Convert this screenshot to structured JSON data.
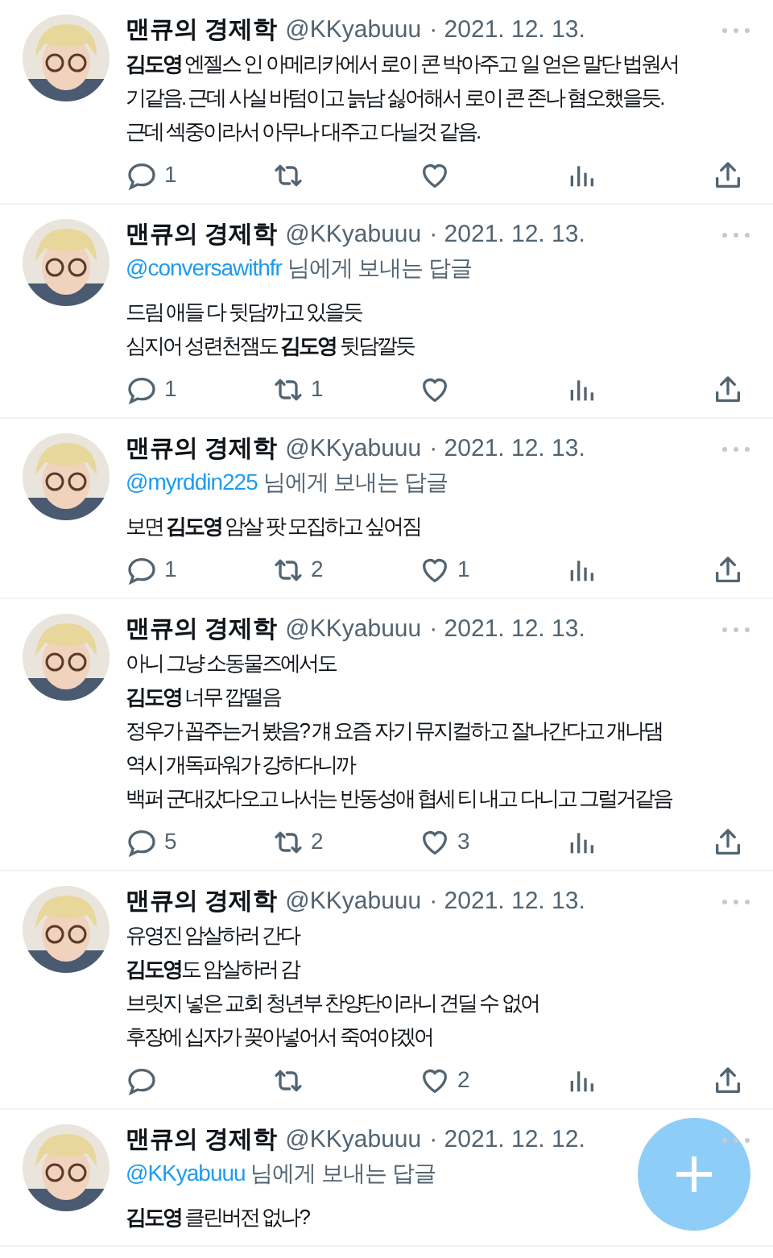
{
  "tweets": [
    {
      "name": "맨큐의 경제학",
      "handle": "@KKyabuuu",
      "date": "· 2021. 12. 13.",
      "lines": [
        "**김도영** 엔젤스 인 아메리카에서 로이 콘 박아주고 일 얻은 말단 법원서",
        "기같음. 근데 사실 바텀이고 늙남 싫어해서 로이 콘 존나 혐오했을듯.",
        "근데 섹중이라서 아무나 대주고 다닐것 같음."
      ],
      "actions": {
        "reply": "1"
      }
    },
    {
      "name": "맨큐의 경제학",
      "handle": "@KKyabuuu",
      "date": "· 2021. 12. 13.",
      "reply_to": {
        "handle": "@conversawithfr",
        "suffix": "님에게 보내는 답글"
      },
      "lines": [
        "드림 애들 다 뒷담까고 있을듯",
        "심지어 성련천잼도 **김도영** 뒷담깔듯"
      ],
      "actions": {
        "reply": "1",
        "retweet": "1"
      }
    },
    {
      "name": "맨큐의 경제학",
      "handle": "@KKyabuuu",
      "date": "· 2021. 12. 13.",
      "reply_to": {
        "handle": "@myrddin225",
        "suffix": "님에게 보내는 답글"
      },
      "lines": [
        "보면 **김도영** 암살 팟 모집하고 싶어짐"
      ],
      "actions": {
        "reply": "1",
        "retweet": "2",
        "like": "1"
      }
    },
    {
      "name": "맨큐의 경제학",
      "handle": "@KKyabuuu",
      "date": "· 2021. 12. 13.",
      "lines": [
        "아니 그냥 소동물즈에서도",
        "**김도영** 너무 깝떨음",
        "정우가 꼽주는거 봤음? 걔 요즘 자기 뮤지컬하고 잘나간다고 개나댐",
        "역시 개독파워가 강하다니까",
        "백퍼 군대갔다오고 나서는 반동성애 협세 티 내고 다니고 그럴거같음"
      ],
      "actions": {
        "reply": "5",
        "retweet": "2",
        "like": "3"
      }
    },
    {
      "name": "맨큐의 경제학",
      "handle": "@KKyabuuu",
      "date": "· 2021. 12. 13.",
      "lines": [
        "유영진 암살하러 간다",
        "**김도영**도 암살하러 감",
        "브릿지 넣은 교회 청년부 찬양단이라니 견딜 수 없어",
        "후장에 십자가 꽂아넣어서 죽여야겠어"
      ],
      "actions": {
        "like": "2"
      }
    },
    {
      "name": "맨큐의 경제학",
      "handle": "@KKyabuuu",
      "date": "· 2021. 12. 12.",
      "reply_to": {
        "handle": "@KKyabuuu",
        "suffix": "님에게 보내는 답글"
      },
      "lines": [
        "**김도영** 클린버전 없나?"
      ]
    }
  ]
}
